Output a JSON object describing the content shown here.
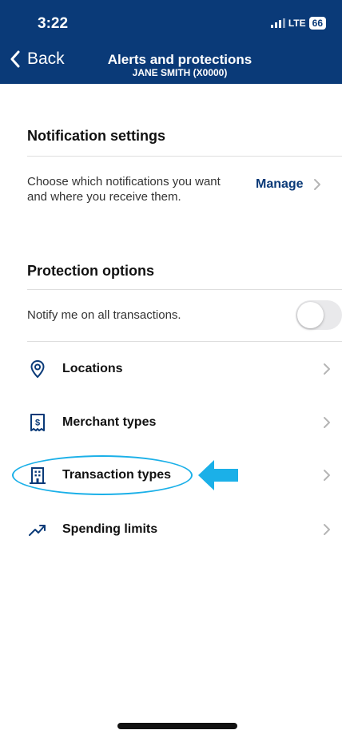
{
  "status_bar": {
    "time": "3:22",
    "network": "LTE",
    "battery": "66"
  },
  "nav": {
    "back_label": "Back",
    "title": "Alerts and protections",
    "subtitle": "JANE SMITH (X0000)"
  },
  "notification_settings": {
    "heading": "Notification settings",
    "description": "Choose which notifications you want and where you receive them.",
    "manage_label": "Manage"
  },
  "protection_options": {
    "heading": "Protection options",
    "notify_label": "Notify me on all transactions.",
    "notify_enabled": false,
    "items": [
      {
        "label": "Locations",
        "icon": "location-pin-icon"
      },
      {
        "label": "Merchant types",
        "icon": "receipt-dollar-icon"
      },
      {
        "label": "Transaction types",
        "icon": "building-icon"
      },
      {
        "label": "Spending limits",
        "icon": "trend-up-icon"
      }
    ]
  },
  "annotation": {
    "highlighted_item": "Transaction types",
    "color": "#1bb0e8"
  },
  "colors": {
    "header_bg": "#0a3a78",
    "accent": "#0a3a78"
  }
}
